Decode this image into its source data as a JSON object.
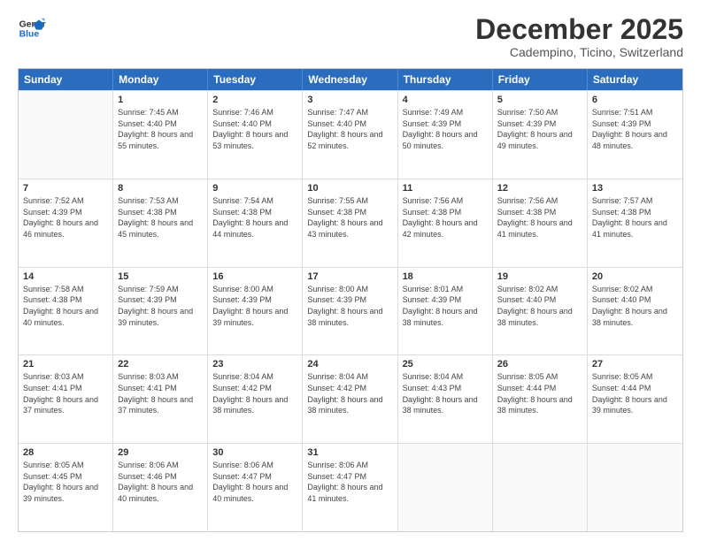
{
  "header": {
    "logo_line1": "General",
    "logo_line2": "Blue",
    "month_title": "December 2025",
    "subtitle": "Cadempino, Ticino, Switzerland"
  },
  "weekdays": [
    "Sunday",
    "Monday",
    "Tuesday",
    "Wednesday",
    "Thursday",
    "Friday",
    "Saturday"
  ],
  "rows": [
    [
      {
        "day": "",
        "empty": true
      },
      {
        "day": "1",
        "sunrise": "7:45 AM",
        "sunset": "4:40 PM",
        "daylight": "8 hours and 55 minutes."
      },
      {
        "day": "2",
        "sunrise": "7:46 AM",
        "sunset": "4:40 PM",
        "daylight": "8 hours and 53 minutes."
      },
      {
        "day": "3",
        "sunrise": "7:47 AM",
        "sunset": "4:40 PM",
        "daylight": "8 hours and 52 minutes."
      },
      {
        "day": "4",
        "sunrise": "7:49 AM",
        "sunset": "4:39 PM",
        "daylight": "8 hours and 50 minutes."
      },
      {
        "day": "5",
        "sunrise": "7:50 AM",
        "sunset": "4:39 PM",
        "daylight": "8 hours and 49 minutes."
      },
      {
        "day": "6",
        "sunrise": "7:51 AM",
        "sunset": "4:39 PM",
        "daylight": "8 hours and 48 minutes."
      }
    ],
    [
      {
        "day": "7",
        "sunrise": "7:52 AM",
        "sunset": "4:39 PM",
        "daylight": "8 hours and 46 minutes."
      },
      {
        "day": "8",
        "sunrise": "7:53 AM",
        "sunset": "4:38 PM",
        "daylight": "8 hours and 45 minutes."
      },
      {
        "day": "9",
        "sunrise": "7:54 AM",
        "sunset": "4:38 PM",
        "daylight": "8 hours and 44 minutes."
      },
      {
        "day": "10",
        "sunrise": "7:55 AM",
        "sunset": "4:38 PM",
        "daylight": "8 hours and 43 minutes."
      },
      {
        "day": "11",
        "sunrise": "7:56 AM",
        "sunset": "4:38 PM",
        "daylight": "8 hours and 42 minutes."
      },
      {
        "day": "12",
        "sunrise": "7:56 AM",
        "sunset": "4:38 PM",
        "daylight": "8 hours and 41 minutes."
      },
      {
        "day": "13",
        "sunrise": "7:57 AM",
        "sunset": "4:38 PM",
        "daylight": "8 hours and 41 minutes."
      }
    ],
    [
      {
        "day": "14",
        "sunrise": "7:58 AM",
        "sunset": "4:38 PM",
        "daylight": "8 hours and 40 minutes."
      },
      {
        "day": "15",
        "sunrise": "7:59 AM",
        "sunset": "4:39 PM",
        "daylight": "8 hours and 39 minutes."
      },
      {
        "day": "16",
        "sunrise": "8:00 AM",
        "sunset": "4:39 PM",
        "daylight": "8 hours and 39 minutes."
      },
      {
        "day": "17",
        "sunrise": "8:00 AM",
        "sunset": "4:39 PM",
        "daylight": "8 hours and 38 minutes."
      },
      {
        "day": "18",
        "sunrise": "8:01 AM",
        "sunset": "4:39 PM",
        "daylight": "8 hours and 38 minutes."
      },
      {
        "day": "19",
        "sunrise": "8:02 AM",
        "sunset": "4:40 PM",
        "daylight": "8 hours and 38 minutes."
      },
      {
        "day": "20",
        "sunrise": "8:02 AM",
        "sunset": "4:40 PM",
        "daylight": "8 hours and 38 minutes."
      }
    ],
    [
      {
        "day": "21",
        "sunrise": "8:03 AM",
        "sunset": "4:41 PM",
        "daylight": "8 hours and 37 minutes."
      },
      {
        "day": "22",
        "sunrise": "8:03 AM",
        "sunset": "4:41 PM",
        "daylight": "8 hours and 37 minutes."
      },
      {
        "day": "23",
        "sunrise": "8:04 AM",
        "sunset": "4:42 PM",
        "daylight": "8 hours and 38 minutes."
      },
      {
        "day": "24",
        "sunrise": "8:04 AM",
        "sunset": "4:42 PM",
        "daylight": "8 hours and 38 minutes."
      },
      {
        "day": "25",
        "sunrise": "8:04 AM",
        "sunset": "4:43 PM",
        "daylight": "8 hours and 38 minutes."
      },
      {
        "day": "26",
        "sunrise": "8:05 AM",
        "sunset": "4:44 PM",
        "daylight": "8 hours and 38 minutes."
      },
      {
        "day": "27",
        "sunrise": "8:05 AM",
        "sunset": "4:44 PM",
        "daylight": "8 hours and 39 minutes."
      }
    ],
    [
      {
        "day": "28",
        "sunrise": "8:05 AM",
        "sunset": "4:45 PM",
        "daylight": "8 hours and 39 minutes."
      },
      {
        "day": "29",
        "sunrise": "8:06 AM",
        "sunset": "4:46 PM",
        "daylight": "8 hours and 40 minutes."
      },
      {
        "day": "30",
        "sunrise": "8:06 AM",
        "sunset": "4:47 PM",
        "daylight": "8 hours and 40 minutes."
      },
      {
        "day": "31",
        "sunrise": "8:06 AM",
        "sunset": "4:47 PM",
        "daylight": "8 hours and 41 minutes."
      },
      {
        "day": "",
        "empty": true
      },
      {
        "day": "",
        "empty": true
      },
      {
        "day": "",
        "empty": true
      }
    ]
  ]
}
